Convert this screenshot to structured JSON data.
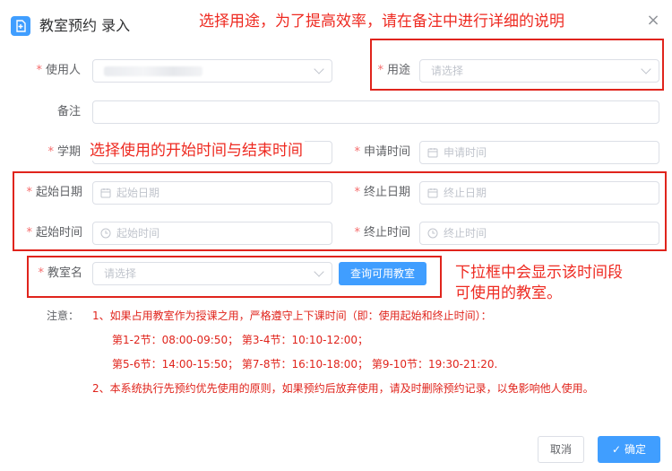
{
  "dialog": {
    "title": "教室预约 录入",
    "close_symbol": "×"
  },
  "annotations": {
    "purpose_hint": "选择用途，为了提高效率，请在备注中进行详细的说明",
    "time_hint": "选择使用的开始时间与结束时间",
    "room_hint_line1": "下拉框中会显示该时间段",
    "room_hint_line2": "可使用的教室。"
  },
  "form": {
    "user_label": "使用人",
    "purpose_label": "用途",
    "purpose_placeholder": "请选择",
    "remark_label": "备注",
    "remark_value": "",
    "term_label": "学期",
    "apply_time_label": "申请时间",
    "apply_time_placeholder": "申请时间",
    "start_date_label": "起始日期",
    "start_date_placeholder": "起始日期",
    "end_date_label": "终止日期",
    "end_date_placeholder": "终止日期",
    "start_time_label": "起始时间",
    "start_time_placeholder": "起始时间",
    "end_time_label": "终止时间",
    "end_time_placeholder": "终止时间",
    "room_label": "教室名",
    "room_placeholder": "请选择",
    "query_button": "查询可用教室",
    "required_mark": "*"
  },
  "notice": {
    "label": "注意：",
    "line1": "1、如果占用教室作为授课之用，严格遵守上下课时间（即：使用起始和终止时间）：",
    "line2": "第1-2节：08:00-09:50； 第3-4节：10:10-12:00；",
    "line3": "第5-6节：14:00-15:50； 第7-8节：16:10-18:00； 第9-10节：19:30-21:20.",
    "line4": "2、本系统执行先预约优先使用的原则，如果预约后放弃使用，请及时删除预约记录，以免影响他人使用。"
  },
  "footer": {
    "cancel_label": "取消",
    "confirm_label": "确定",
    "confirm_icon": "✓"
  },
  "colors": {
    "primary": "#409eff",
    "annotation_red": "#e0241c",
    "required_red": "#f56c6c"
  }
}
